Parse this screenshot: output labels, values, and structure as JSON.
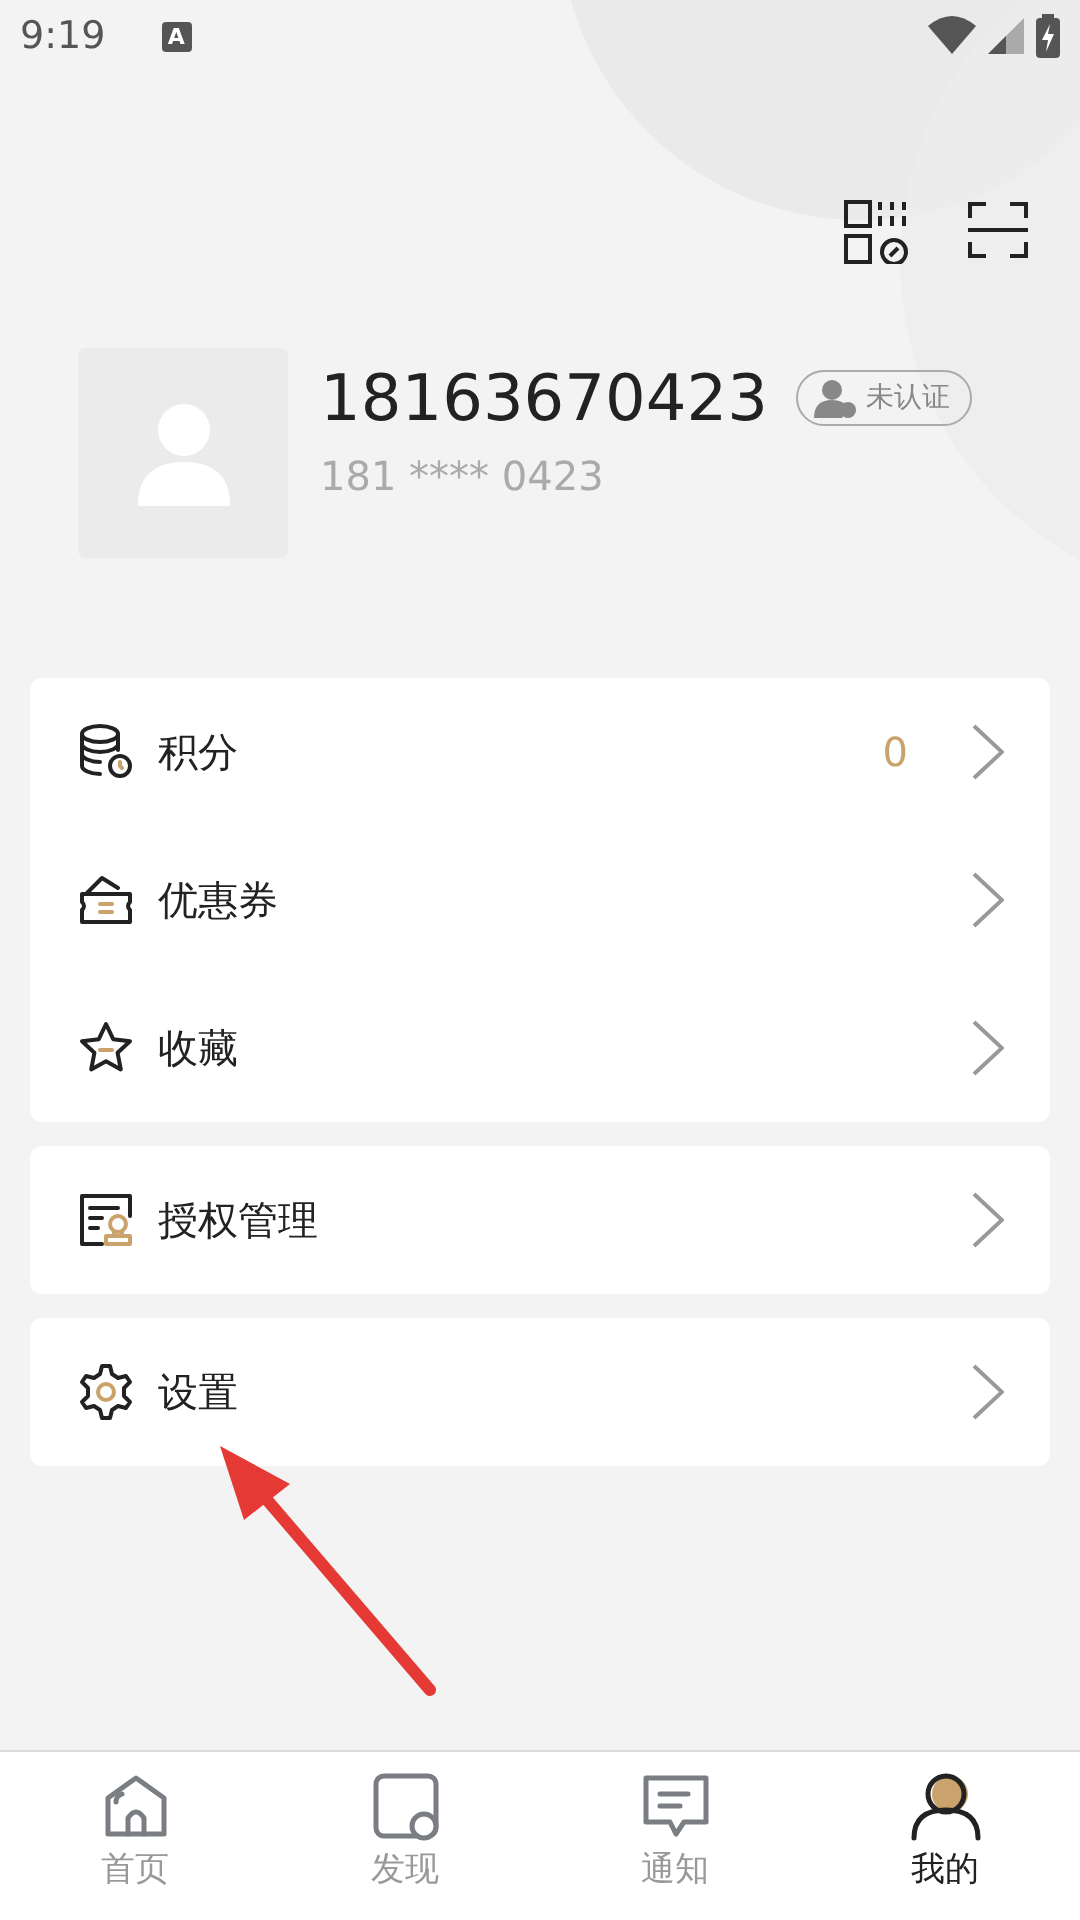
{
  "status_bar": {
    "time": "9:19",
    "notification": "A"
  },
  "profile": {
    "phone": "18163670423",
    "masked_phone": "181 **** 0423",
    "verify_badge": "未认证"
  },
  "menu_groups": [
    {
      "items": [
        {
          "label": "积分",
          "value": "0"
        },
        {
          "label": "优惠券"
        },
        {
          "label": "收藏"
        }
      ]
    },
    {
      "items": [
        {
          "label": "授权管理"
        }
      ]
    },
    {
      "items": [
        {
          "label": "设置"
        }
      ]
    }
  ],
  "tabs": [
    {
      "label": "首页",
      "selected": false
    },
    {
      "label": "发现",
      "selected": false
    },
    {
      "label": "通知",
      "selected": false
    },
    {
      "label": "我的",
      "selected": true
    }
  ]
}
